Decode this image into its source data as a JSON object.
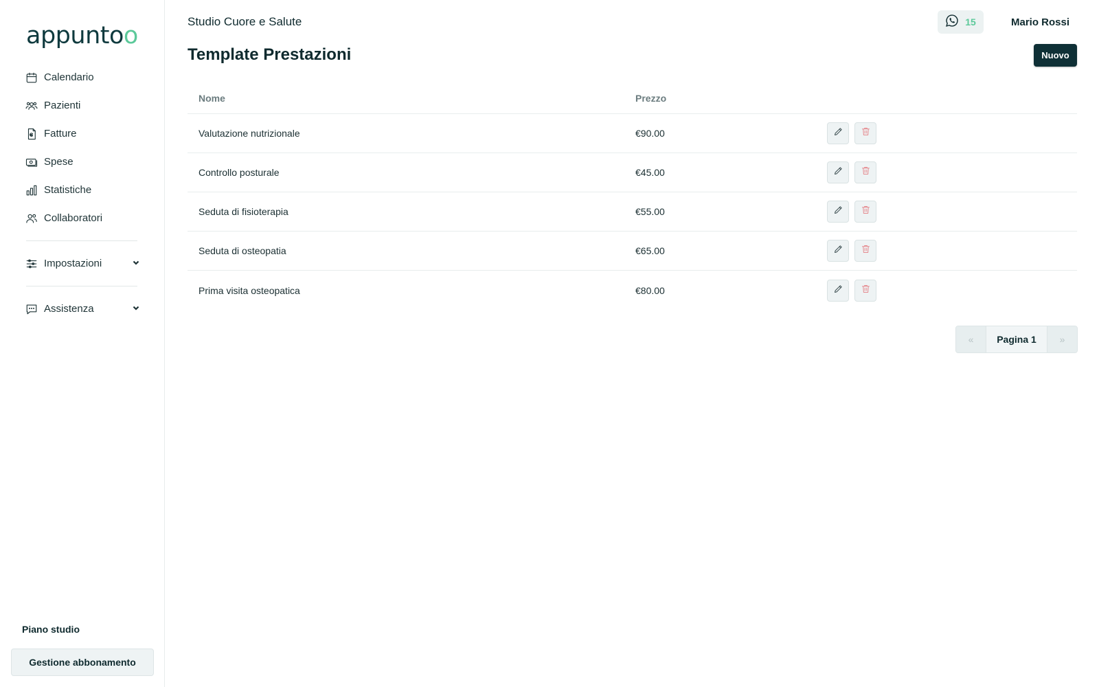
{
  "brand": {
    "logo_text_start": "appunt",
    "logo_o1": "o",
    "logo_o2": "o",
    "accent_color": "#5cc99a",
    "dark_color": "#0f3036"
  },
  "sidebar": {
    "items": [
      {
        "label": "Calendario",
        "icon": "calendar-icon"
      },
      {
        "label": "Pazienti",
        "icon": "users-icon"
      },
      {
        "label": "Fatture",
        "icon": "invoice-icon"
      },
      {
        "label": "Spese",
        "icon": "money-icon"
      },
      {
        "label": "Statistiche",
        "icon": "bar-chart-icon"
      },
      {
        "label": "Collaboratori",
        "icon": "team-icon"
      }
    ],
    "settings": {
      "label": "Impostazioni",
      "icon": "sliders-icon"
    },
    "support": {
      "label": "Assistenza",
      "icon": "chat-icon"
    },
    "plan_label": "Piano studio",
    "plan_button": "Gestione abbonamento"
  },
  "header": {
    "studio_name": "Studio Cuore e Salute",
    "whatsapp_count": "15",
    "user_name": "Mario Rossi"
  },
  "main": {
    "title": "Template Prestazioni",
    "new_button": "Nuovo",
    "table": {
      "columns": [
        "Nome",
        "Prezzo"
      ],
      "rows": [
        {
          "name": "Valutazione nutrizionale",
          "price": "€90.00"
        },
        {
          "name": "Controllo posturale",
          "price": "€45.00"
        },
        {
          "name": "Seduta di fisioterapia",
          "price": "€55.00"
        },
        {
          "name": "Seduta di osteopatia",
          "price": "€65.00"
        },
        {
          "name": "Prima visita osteopatica",
          "price": "€80.00"
        }
      ]
    },
    "pagination": {
      "prev": "«",
      "label": "Pagina 1",
      "next": "»"
    }
  }
}
